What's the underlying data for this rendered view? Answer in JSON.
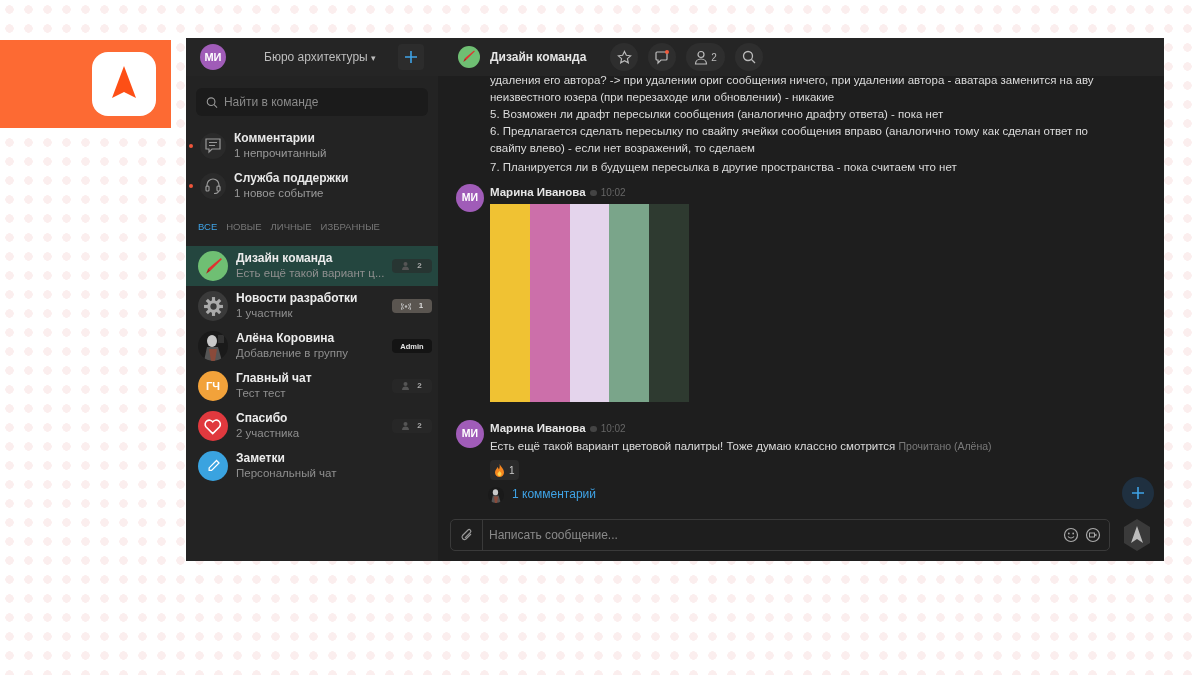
{
  "team": {
    "avatar": "МИ",
    "name": "Бюро архитектуры",
    "caret": "▾"
  },
  "search": {
    "placeholder": "Найти в команде"
  },
  "specials": [
    {
      "kind": "comments",
      "title": "Комментарии",
      "subtitle": "1 непрочитанный",
      "unread": true
    },
    {
      "kind": "support",
      "title": "Служба поддержки",
      "subtitle": "1 новое событие",
      "unread": true
    }
  ],
  "filters": [
    {
      "label": "ВСЕ",
      "selected": true
    },
    {
      "label": "НОВЫЕ",
      "selected": false
    },
    {
      "label": "ЛИЧНЫЕ",
      "selected": false
    },
    {
      "label": "ИЗБРАННЫЕ",
      "selected": false
    }
  ],
  "chats": [
    {
      "kind": "crayon",
      "title": "Дизайн команда",
      "subtitle": "Есть ещё такой вариант ц...",
      "badge": {
        "kind": "members",
        "text": "2"
      },
      "selected": true
    },
    {
      "kind": "gear",
      "title": "Новости разработки",
      "subtitle": "1 участник",
      "badge": {
        "kind": "broadcast",
        "text": "1"
      },
      "selected": false
    },
    {
      "kind": "picture",
      "title": "Алёна Коровина",
      "subtitle": "Добавление в группу",
      "badge": {
        "kind": "role",
        "text": "Admin"
      },
      "selected": false
    },
    {
      "kind": "initials",
      "initials": "ГЧ",
      "title": "Главный чат",
      "subtitle": "Тест тест",
      "badge": {
        "kind": "members",
        "text": "2"
      },
      "selected": false
    },
    {
      "kind": "heart",
      "title": "Спасибо",
      "subtitle": "2 участника",
      "badge": {
        "kind": "members",
        "text": "2"
      },
      "selected": false
    },
    {
      "kind": "pencil",
      "title": "Заметки",
      "subtitle": "Персональный чат",
      "selected": false
    }
  ],
  "chat_header": {
    "kind": "crayon",
    "title": "Дизайн команда",
    "members": "2"
  },
  "messages": [
    {
      "kind": "text",
      "paragraphs": [
        "удаления его автора? -> при удалении ориг сообщения ничего, при удалении автора - аватара заменится на аву неизвестного юзера (при перезаходе или обновлении) - никакие",
        "5. Возможен ли драфт пересылки сообщения (аналогично драфту ответа) - пока нет",
        "6. Предлагается сделать пересылку по свайпу ячейки сообщения вправо (аналогично тому как сделан ответ по свайпу влево) - если нет возражений, то сделаем",
        "7. Планируется ли в будущем пересылка в другие пространства - пока считаем что нет"
      ]
    },
    {
      "kind": "palette",
      "avatar": "МИ",
      "author": "Марина Иванова",
      "time": "10:02",
      "swatches": [
        {
          "color": "#f0c233"
        },
        {
          "color": "#cc6faa"
        },
        {
          "color": "#e4d4ec"
        },
        {
          "color": "#7aa58a"
        },
        {
          "color": "#2e3a30"
        }
      ]
    },
    {
      "kind": "text",
      "avatar": "МИ",
      "author": "Марина Иванова",
      "time": "10:02",
      "paragraphs": [
        "Есть ещё такой вариант цветовой палитры! Тоже думаю классно смотрится"
      ],
      "read": "Прочитано (Алёна)",
      "reaction": {
        "count": "1"
      },
      "comments": "1 комментарий"
    }
  ],
  "composer": {
    "placeholder": "Написать сообщение..."
  }
}
